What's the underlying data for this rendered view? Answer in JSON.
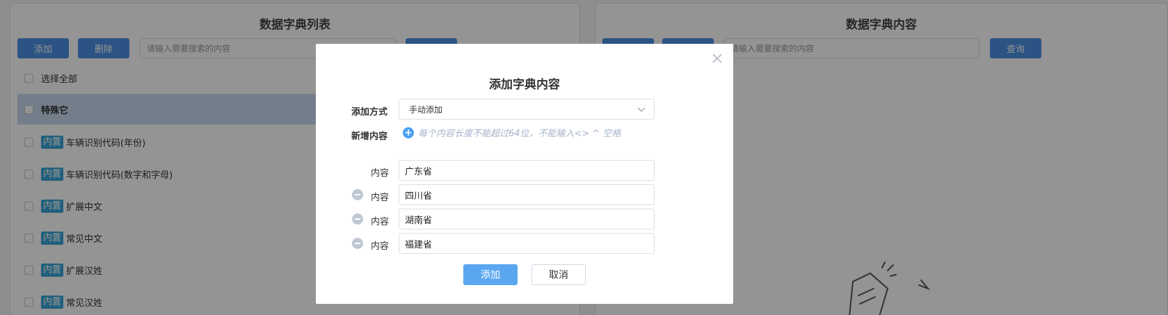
{
  "left_panel": {
    "title": "数据字典列表",
    "add_label": "添加",
    "delete_label": "删除",
    "search_placeholder": "请输入需要搜索的内容",
    "select_all_label": "选择全部",
    "items": [
      {
        "tag": "",
        "label": "特殊它"
      },
      {
        "tag": "内置",
        "label": "车辆识别代码(年份)"
      },
      {
        "tag": "内置",
        "label": "车辆识别代码(数字和字母)"
      },
      {
        "tag": "内置",
        "label": "扩展中文"
      },
      {
        "tag": "内置",
        "label": "常见中文"
      },
      {
        "tag": "内置",
        "label": "扩展汉姓"
      },
      {
        "tag": "内置",
        "label": "常见汉姓"
      }
    ]
  },
  "right_panel": {
    "title": "数据字典内容",
    "search_placeholder": "请输入需要搜索的内容",
    "query_label": "查询"
  },
  "modal": {
    "title": "添加字典内容",
    "method_label": "添加方式",
    "method_value": "手动添加",
    "new_content_label": "新增内容",
    "hint_text": "每个内容长度不能超过64位，不能输入<> ^ 空格",
    "content_label": "内容",
    "contents": [
      "广东省",
      "四川省",
      "湖南省",
      "福建省"
    ],
    "confirm_label": "添加",
    "cancel_label": "取消"
  },
  "colors": {
    "primary": "#4a90e2",
    "tag": "#3aa5d8",
    "selected_row": "#c9d9f0",
    "overlay": "rgba(0,0,0,0.42)"
  }
}
